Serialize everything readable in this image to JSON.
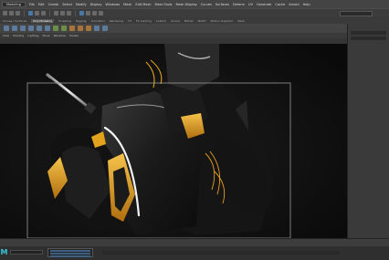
{
  "app": {
    "name": "Maya",
    "logo_letter": "M"
  },
  "menubar": {
    "mode": "Modeling",
    "items": [
      "File",
      "Edit",
      "Create",
      "Select",
      "Modify",
      "Display",
      "Windows",
      "Mesh",
      "Edit Mesh",
      "Mesh Tools",
      "Mesh Display",
      "Curves",
      "Surfaces",
      "Deform",
      "UV",
      "Generate",
      "Cache",
      "Arnold",
      "Help"
    ]
  },
  "shelfbar": {
    "search_value": ""
  },
  "shelf_tabs": {
    "items": [
      "Curves / Surfaces",
      "Poly Modeling",
      "Sculpting",
      "Rigging",
      "Animation",
      "Rendering",
      "FX",
      "FX Caching",
      "Custom",
      "Arnold",
      "Bifrost",
      "MASH",
      "Motion Graphics",
      "XGen"
    ],
    "active": "Poly Modeling"
  },
  "viewport": {
    "menu": [
      "View",
      "Shading",
      "Lighting",
      "Show",
      "Renderer",
      "Panels"
    ],
    "render_region": {
      "visible": true
    }
  },
  "right_panel": {
    "title": "",
    "tabs": []
  },
  "colors": {
    "ui_bg": "#2b2b2b",
    "accent_orange": "#e2a21c",
    "viewport_bg": "#0e0e0e",
    "maya_logo": "#36c3d8"
  }
}
